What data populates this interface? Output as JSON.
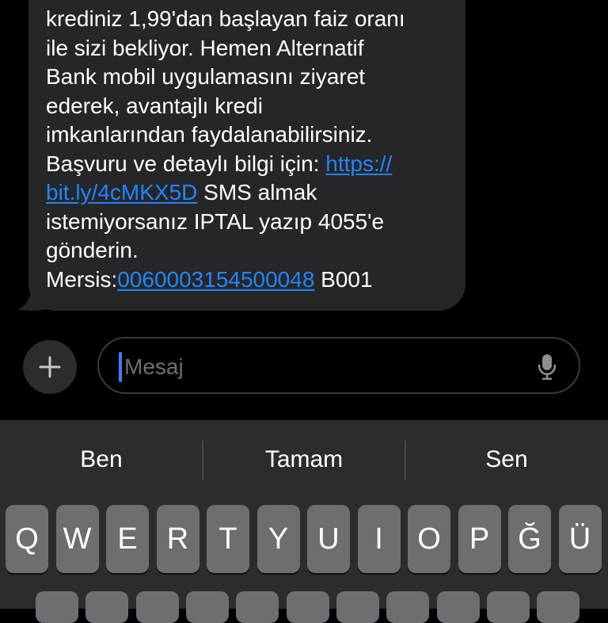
{
  "message": {
    "lines": [
      [
        {
          "t": "krediniz 1,99'dan başlayan faiz oranı"
        }
      ],
      [
        {
          "t": "ile sizi bekliyor. Hemen Alternatif"
        }
      ],
      [
        {
          "t": "Bank mobil uygulamasını ziyaret"
        }
      ],
      [
        {
          "t": "ederek, avantajlı kredi"
        }
      ],
      [
        {
          "t": "imkanlarından faydalanabilirsiniz."
        }
      ],
      [
        {
          "t": "Başvuru ve detaylı bilgi için: "
        },
        {
          "t": "https://",
          "link": true
        }
      ],
      [
        {
          "t": "bit.ly/4cMKX5D",
          "link": true
        },
        {
          "t": " SMS almak"
        }
      ],
      [
        {
          "t": "istemiyorsanız IPTAL yazıp 4055'e"
        }
      ],
      [
        {
          "t": "gönderin."
        }
      ],
      [
        {
          "t": "Mersis:"
        },
        {
          "t": "0060003154500048",
          "link": true
        },
        {
          "t": " B001"
        }
      ]
    ]
  },
  "compose": {
    "placeholder": "Mesaj",
    "plus_icon": "plus-icon",
    "mic_icon": "microphone-icon"
  },
  "keyboard": {
    "suggestions": [
      "Ben",
      "Tamam",
      "Sen"
    ],
    "row1": [
      "Q",
      "W",
      "E",
      "R",
      "T",
      "Y",
      "U",
      "I",
      "O",
      "P",
      "Ğ",
      "Ü"
    ]
  },
  "colors": {
    "background": "#000000",
    "bubble": "#262628",
    "link": "#1f86ff",
    "keyboard": "#2c2c2e",
    "key": "#6e6e72"
  }
}
